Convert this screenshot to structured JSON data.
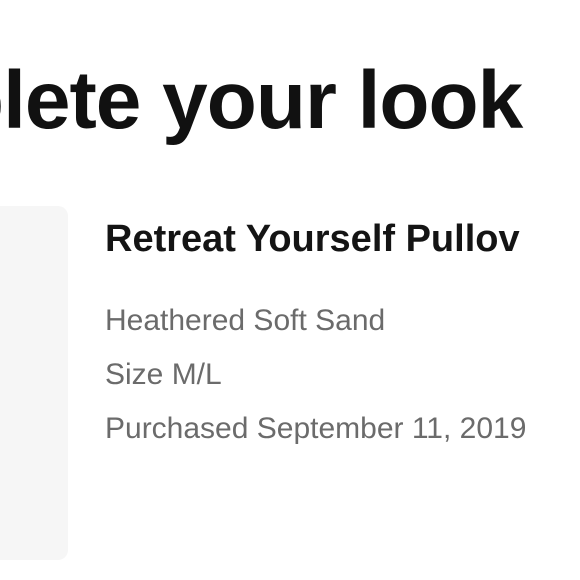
{
  "section": {
    "heading": "plete your look"
  },
  "product": {
    "title": "Retreat Yourself Pullov",
    "color": "Heathered Soft Sand",
    "size": "Size M/L",
    "purchased": "Purchased September 11, 2019"
  },
  "colors": {
    "heading_text": "#111111",
    "meta_text": "#6b6b6b",
    "card_background": "#f6f6f6"
  }
}
